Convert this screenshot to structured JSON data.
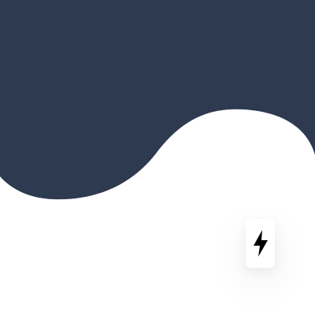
{
  "theme": {
    "background": "#ffffff",
    "hero_color": "#2d3a50",
    "icon_color": "#000000"
  },
  "hero": {
    "shape": "wave-header"
  },
  "quick_action": {
    "icon": "lightning-bolt-icon"
  }
}
